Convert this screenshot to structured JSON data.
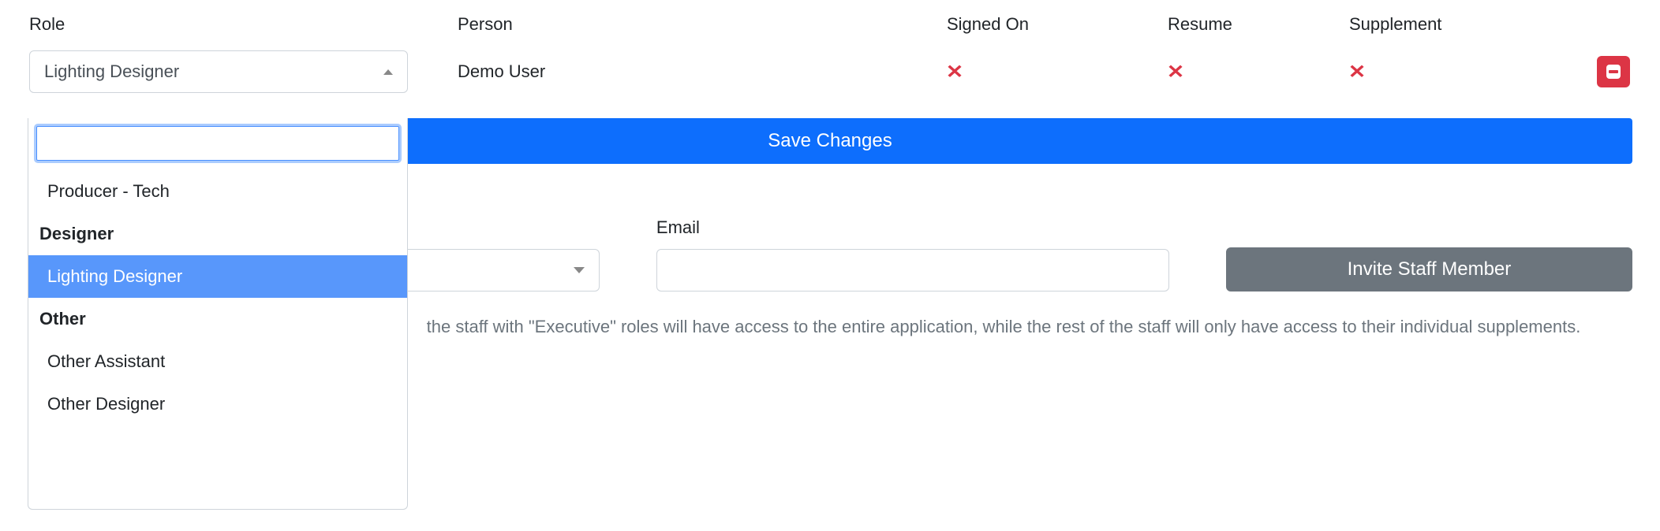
{
  "headers": {
    "role": "Role",
    "person": "Person",
    "signed_on": "Signed On",
    "resume": "Resume",
    "supplement": "Supplement"
  },
  "row": {
    "role_selected": "Lighting Designer",
    "person": "Demo User"
  },
  "buttons": {
    "save": "Save Changes",
    "invite": "Invite Staff Member"
  },
  "invite": {
    "email_label": "Email"
  },
  "help_text": "the staff with \"Executive\" roles will have access to the entire application, while the rest of the staff will only have access to their individual supplements.",
  "dropdown": {
    "ungrouped": [
      "Producer - Tech"
    ],
    "groups": [
      {
        "label": "Designer",
        "items": [
          "Lighting Designer"
        ]
      },
      {
        "label": "Other",
        "items": [
          "Other Assistant",
          "Other Designer"
        ]
      }
    ],
    "selected": "Lighting Designer"
  }
}
